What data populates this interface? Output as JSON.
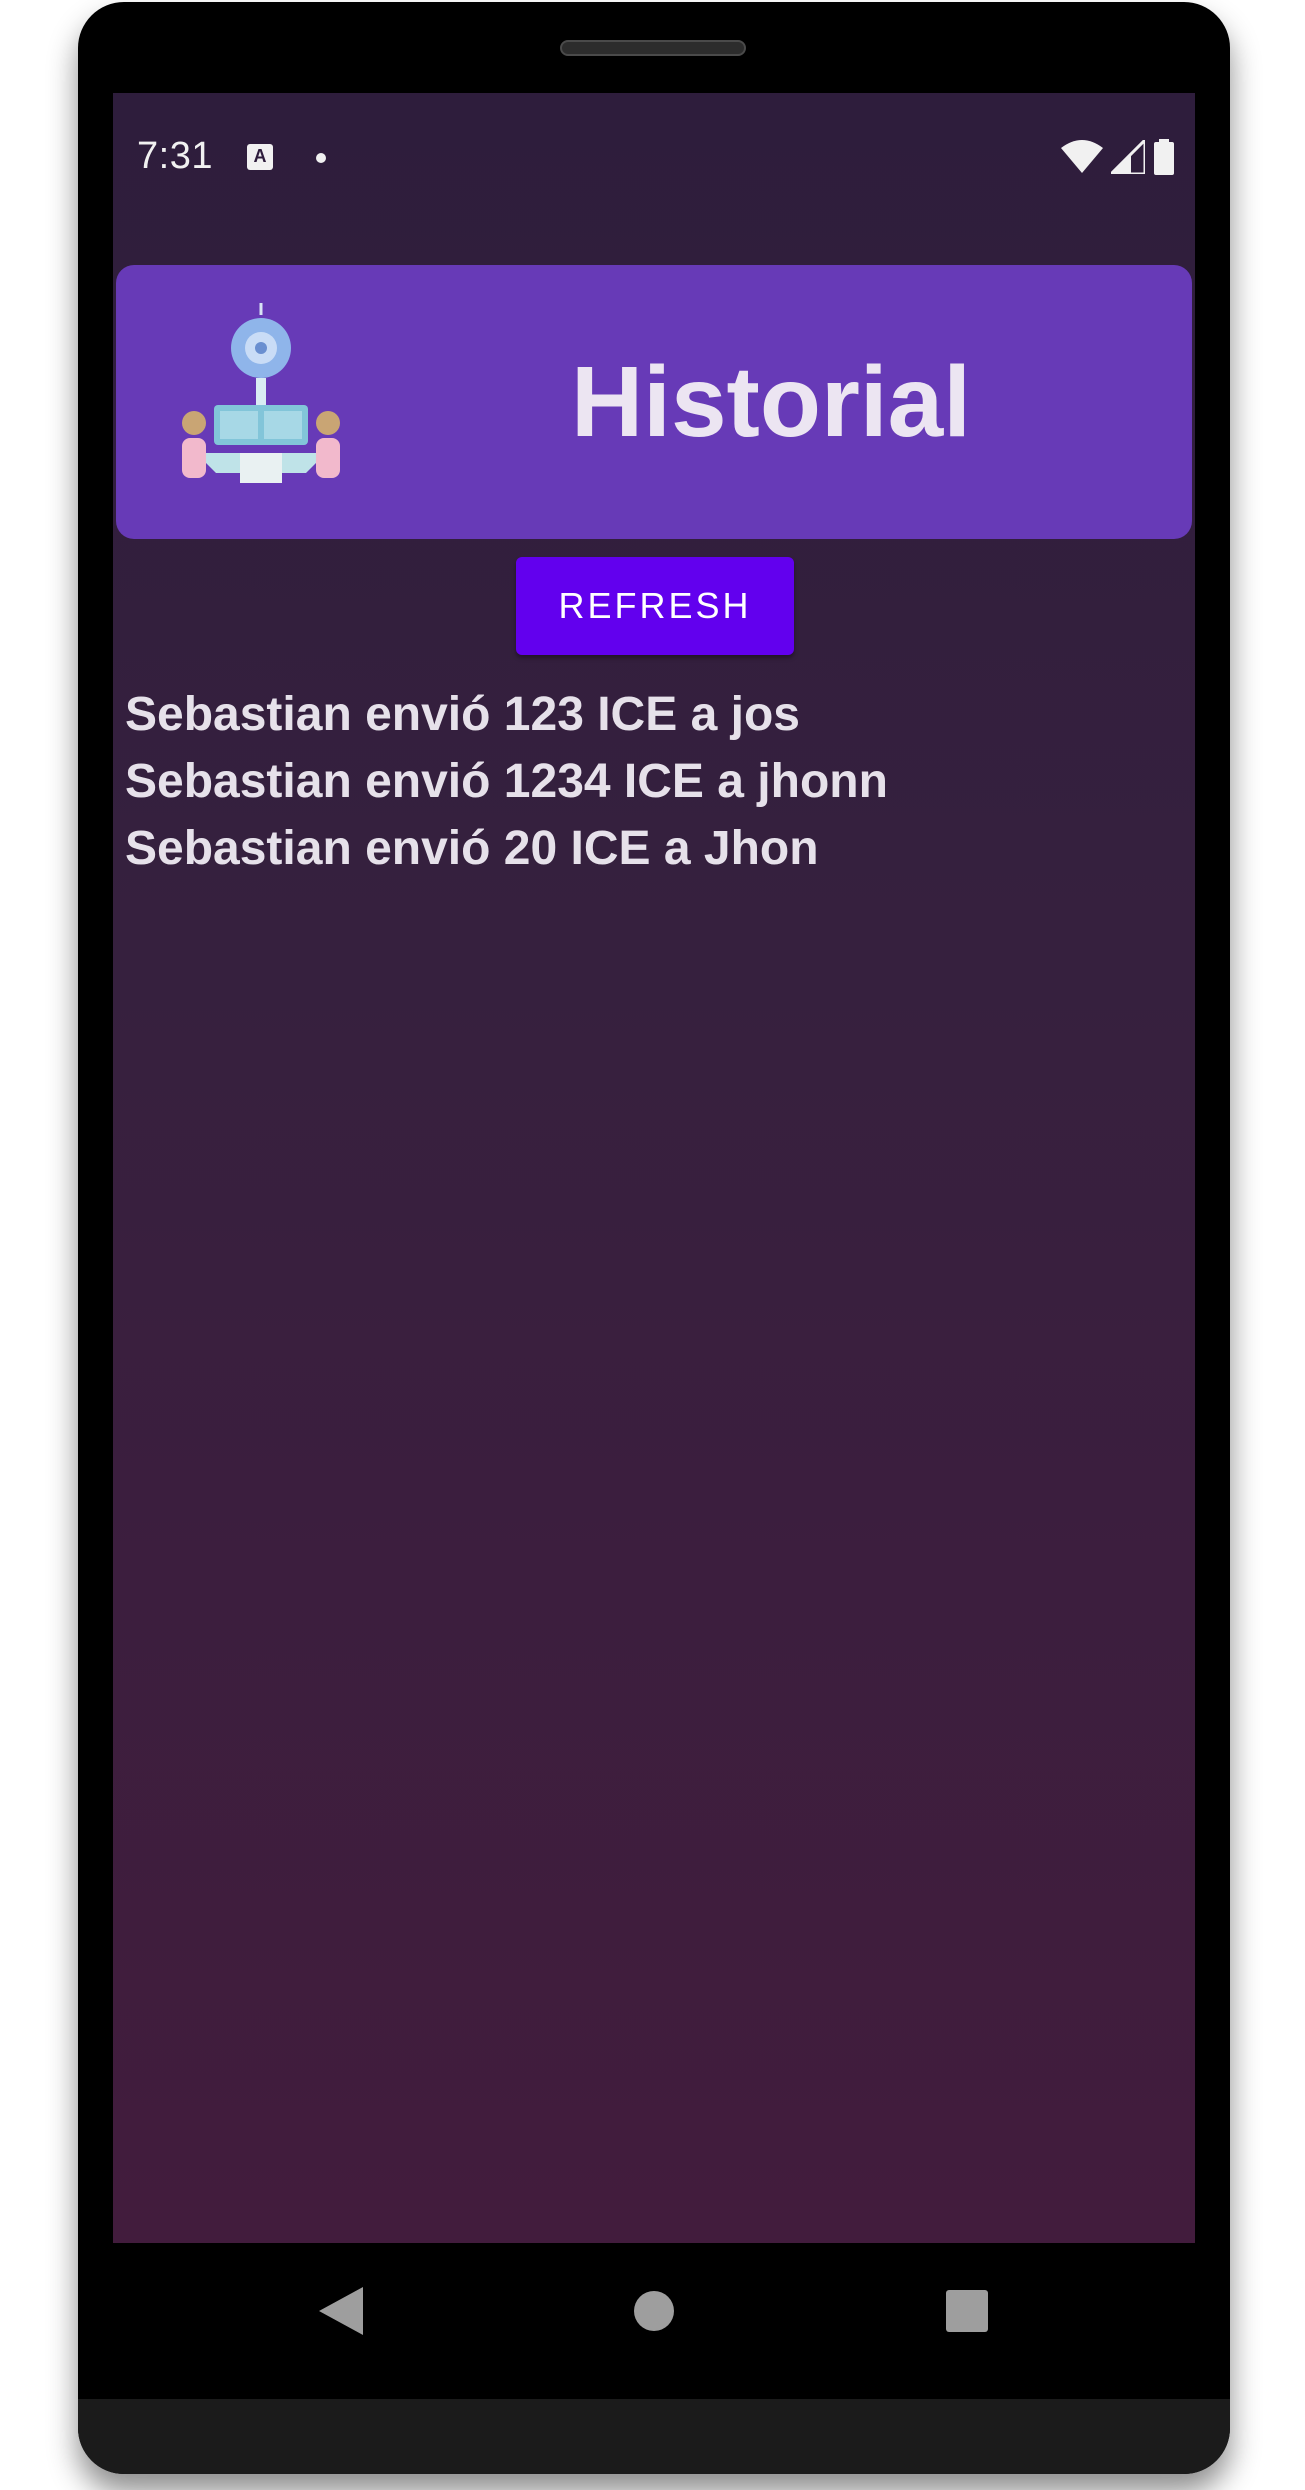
{
  "status_bar": {
    "time": "7:31",
    "app_icon_glyph": "A",
    "icons": [
      "notification-dot-icon",
      "wifi-icon",
      "cell-signal-icon",
      "battery-icon"
    ]
  },
  "header": {
    "title": "Historial",
    "illustration_icon": "people-network-illustration",
    "background_color": "#673ab7"
  },
  "actions": {
    "refresh_label": "REFRESH",
    "accent_color": "#6200ee"
  },
  "history": {
    "items": [
      "Sebastian envió 123 ICE a jos",
      "Sebastian envió 1234 ICE a jhonn",
      "Sebastian envió 20 ICE a Jhon"
    ]
  },
  "navigation": {
    "buttons": [
      "back-icon",
      "home-icon",
      "recents-icon"
    ]
  }
}
